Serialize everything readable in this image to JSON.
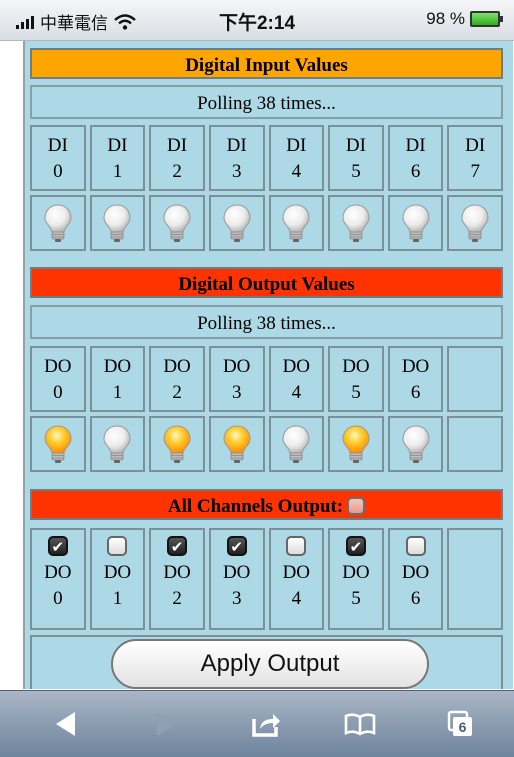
{
  "status_bar": {
    "carrier": "中華電信",
    "time": "下午2:14",
    "battery": "98 %"
  },
  "input_section": {
    "title": "Digital Input Values",
    "polling": "Polling 38 times...",
    "channels": [
      {
        "label1": "DI",
        "label2": "0",
        "lamp": "off"
      },
      {
        "label1": "DI",
        "label2": "1",
        "lamp": "off"
      },
      {
        "label1": "DI",
        "label2": "2",
        "lamp": "off"
      },
      {
        "label1": "DI",
        "label2": "3",
        "lamp": "off"
      },
      {
        "label1": "DI",
        "label2": "4",
        "lamp": "off"
      },
      {
        "label1": "DI",
        "label2": "5",
        "lamp": "off"
      },
      {
        "label1": "DI",
        "label2": "6",
        "lamp": "off"
      },
      {
        "label1": "DI",
        "label2": "7",
        "lamp": "off"
      }
    ]
  },
  "output_section": {
    "title": "Digital Output Values",
    "polling": "Polling 38 times...",
    "channels": [
      {
        "label1": "DO",
        "label2": "0",
        "lamp": "on"
      },
      {
        "label1": "DO",
        "label2": "1",
        "lamp": "off"
      },
      {
        "label1": "DO",
        "label2": "2",
        "lamp": "on"
      },
      {
        "label1": "DO",
        "label2": "3",
        "lamp": "on"
      },
      {
        "label1": "DO",
        "label2": "4",
        "lamp": "off"
      },
      {
        "label1": "DO",
        "label2": "5",
        "lamp": "on"
      },
      {
        "label1": "DO",
        "label2": "6",
        "lamp": "off"
      }
    ]
  },
  "all_channels": {
    "label": "All Channels Output:",
    "checked": false,
    "channels": [
      {
        "label1": "DO",
        "label2": "0",
        "checked": true
      },
      {
        "label1": "DO",
        "label2": "1",
        "checked": false
      },
      {
        "label1": "DO",
        "label2": "2",
        "checked": true
      },
      {
        "label1": "DO",
        "label2": "3",
        "checked": true
      },
      {
        "label1": "DO",
        "label2": "4",
        "checked": false
      },
      {
        "label1": "DO",
        "label2": "5",
        "checked": true
      },
      {
        "label1": "DO",
        "label2": "6",
        "checked": false
      }
    ]
  },
  "apply_button": "Apply Output",
  "toolbar": {
    "tabs_count": "6"
  },
  "colors": {
    "panel": "#add8e6",
    "input_header": "#ffa500",
    "output_header": "#ff3300",
    "bulb_on": "#ffb300",
    "bulb_off": "#e8e8e8"
  },
  "icons": [
    "signal-icon",
    "wifi-icon",
    "battery-icon",
    "lightbulb-icon",
    "checkbox-icon",
    "back-icon",
    "forward-icon",
    "share-icon",
    "bookmarks-icon",
    "tabs-icon"
  ]
}
